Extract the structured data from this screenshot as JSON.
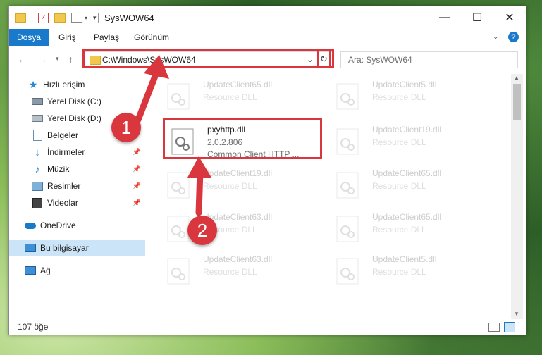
{
  "window": {
    "title": "SysWOW64",
    "controls": {
      "minimize": "—",
      "maximize": "☐",
      "close": "✕"
    }
  },
  "ribbon": {
    "file_tab": "Dosya",
    "tabs": [
      "Giriş",
      "Paylaş",
      "Görünüm"
    ]
  },
  "nav": {
    "address": "C:\\Windows\\SysWOW64",
    "search_placeholder": "Ara: SysWOW64"
  },
  "sidebar": {
    "items": [
      {
        "label": "Hızlı erişim",
        "icon": "star-icon"
      },
      {
        "label": "Yerel Disk (C:)",
        "icon": "drive-icon"
      },
      {
        "label": "Yerel Disk (D:)",
        "icon": "drive-icon"
      },
      {
        "label": "Belgeler",
        "icon": "documents-icon"
      },
      {
        "label": "İndirmeler",
        "icon": "download-icon"
      },
      {
        "label": "Müzik",
        "icon": "music-icon"
      },
      {
        "label": "Resimler",
        "icon": "pictures-icon"
      },
      {
        "label": "Videolar",
        "icon": "video-icon"
      },
      {
        "label": "OneDrive",
        "icon": "cloud-icon"
      },
      {
        "label": "Bu bilgisayar",
        "icon": "computer-icon"
      },
      {
        "label": "Ağ",
        "icon": "network-icon"
      }
    ]
  },
  "files": [
    {
      "name": "UpdateClient65.dll",
      "desc": "Resource DLL"
    },
    {
      "name": "UpdateClient5.dll",
      "desc": "Resource DLL"
    },
    {
      "name": "pxyhttp.dll",
      "version": "2.0.2.806",
      "desc": "Common Client HTTP ..."
    },
    {
      "name": "UpdateClient19.dll",
      "desc": "Resource DLL"
    },
    {
      "name": "UpdateClient19.dll",
      "desc": "Resource DLL"
    },
    {
      "name": "UpdateClient65.dll",
      "desc": "Resource DLL"
    },
    {
      "name": "UpdateClient63.dll",
      "desc": "Resource DLL"
    },
    {
      "name": "UpdateClient65.dll",
      "desc": "Resource DLL"
    },
    {
      "name": "UpdateClient63.dll",
      "desc": "Resource DLL"
    },
    {
      "name": "UpdateClient5.dll",
      "desc": "Resource DLL"
    }
  ],
  "status": {
    "count": "107 öğe"
  },
  "annotations": {
    "step1": "1",
    "step2": "2"
  },
  "colors": {
    "accent": "#1979ca",
    "highlight": "#d9363e"
  }
}
